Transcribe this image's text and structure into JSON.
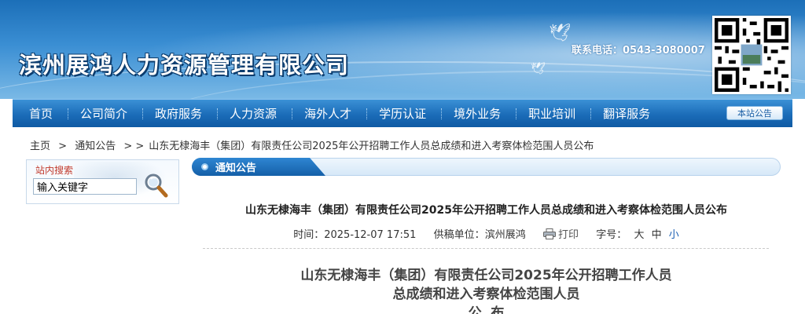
{
  "header": {
    "site_title": "滨州展鸿人力资源管理有限公司",
    "phone": "联系电话：0543-3080007",
    "qr_icon": "qr-code-icon"
  },
  "nav": {
    "items": [
      "首页",
      "公司简介",
      "政府服务",
      "人力资源",
      "海外人才",
      "学历认证",
      "境外业务",
      "职业培训",
      "翻译服务"
    ],
    "notice_button": "本站公告"
  },
  "breadcrumb": {
    "home": "主页",
    "sep1": ">",
    "section": "通知公告",
    "sep2": "> >",
    "current": "山东无棣海丰（集团）有限责任公司2025年公开招聘工作人员总成绩和进入考察体检范围人员公布"
  },
  "search": {
    "title": "站内搜索",
    "value": "输入关键字",
    "icon": "magnifier-icon"
  },
  "section": {
    "title": "通知公告"
  },
  "article": {
    "title": "山东无棣海丰（集团）有限责任公司2025年公开招聘工作人员总成绩和进入考察体检范围人员公布",
    "time_label": "时间：",
    "time": "2025-12-07 17:51",
    "source_label": "供稿单位：",
    "source": "滨州展鸿",
    "print": "打印",
    "font_label": "字号：",
    "font_sizes": [
      "大",
      "中",
      "小"
    ],
    "body_title_line1": "山东无棣海丰（集团）有限责任公司2025年公开招聘工作人员",
    "body_title_line2": "总成绩和进入考察体检范围人员",
    "body_title_line3": "公  布"
  }
}
